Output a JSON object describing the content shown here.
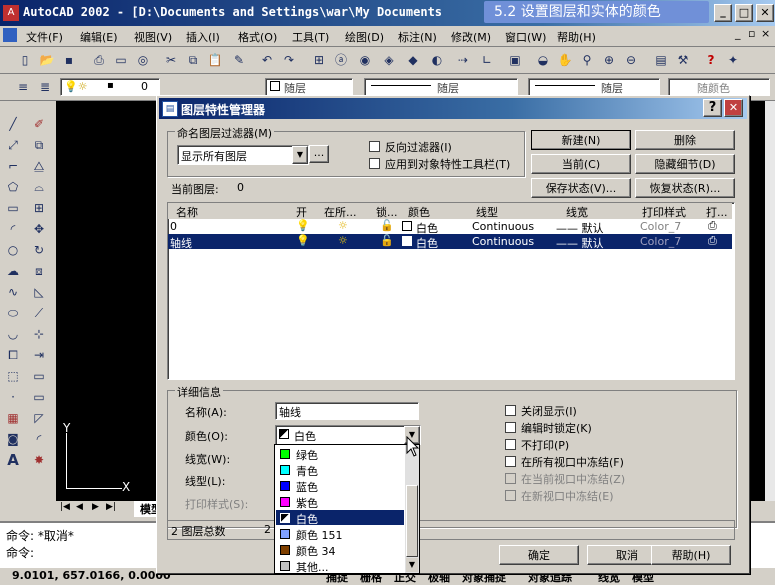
{
  "app": {
    "title": "AutoCAD 2002 - [D:\\Documents and Settings\\war\\My Documents",
    "overlay_title": "5.2 设置图层和实体的颜色",
    "menu": [
      "文件(F)",
      "编辑(E)",
      "视图(V)",
      "插入(I)",
      "格式(O)",
      "工具(T)",
      "绘图(D)",
      "标注(N)",
      "修改(M)",
      "窗口(W)",
      "帮助(H)"
    ],
    "layer_combo": "0",
    "bylayer": "随层",
    "bycolor": "随颜色",
    "model_tab": "模型",
    "command_lines": [
      "命令:  *取消*",
      "命令:"
    ],
    "coords": "9.0101,   657.0166, 0.0000",
    "status_items": [
      "捕捉",
      "栅格",
      "正交",
      "极轴",
      "对象捕捉",
      "对象追踪",
      "线宽",
      "模型"
    ],
    "ucs_x": "X",
    "ucs_y": "Y"
  },
  "dialog": {
    "title": "图层特性管理器",
    "filter_group": "命名图层过滤器(M)",
    "filter_value": "显示所有图层",
    "filter_more": "...",
    "invert_filter": "反向过滤器(I)",
    "apply_toolbar": "应用到对象特性工具栏(T)",
    "current_layer_label": "当前图层:",
    "current_layer": "0",
    "buttons": {
      "new": "新建(N)",
      "delete": "删除",
      "current": "当前(C)",
      "hide_details": "隐藏细节(D)",
      "save_state": "保存状态(V)...",
      "restore_state": "恢复状态(R)...",
      "ok": "确定",
      "cancel": "取消",
      "help": "帮助(H)"
    },
    "columns": [
      "名称",
      "开",
      "在所...",
      "锁...",
      "颜色",
      "线型",
      "线宽",
      "打印样式",
      "打..."
    ],
    "layers": [
      {
        "name": "0",
        "color": "白色",
        "linetype": "Continuous",
        "lineweight": "—— 默认",
        "plotstyle": "Color_7",
        "selected": false
      },
      {
        "name": "轴线",
        "color": "白色",
        "linetype": "Continuous",
        "lineweight": "—— 默认",
        "plotstyle": "Color_7",
        "selected": true
      }
    ],
    "details": {
      "group": "详细信息",
      "name_label": "名称(A):",
      "name_value": "轴线",
      "color_label": "颜色(O):",
      "color_value": "白色",
      "lineweight_label": "线宽(W):",
      "linetype_label": "线型(L):",
      "plotstyle_label": "打印样式(S):",
      "off": "关闭显示(I)",
      "lock": "编辑时锁定(K)",
      "noplot": "不打印(P)",
      "freeze_all": "在所有视口中冻结(F)",
      "freeze_current": "在当前视口中冻结(Z)",
      "freeze_new": "在新视口中冻结(E)"
    },
    "color_options": [
      {
        "label": "绿色",
        "swatch": "#00ff00"
      },
      {
        "label": "青色",
        "swatch": "#00ffff"
      },
      {
        "label": "蓝色",
        "swatch": "#0000ff"
      },
      {
        "label": "紫色",
        "swatch": "#ff00ff"
      },
      {
        "label": "白色",
        "swatch": "#ffffff"
      },
      {
        "label": "颜色 151",
        "swatch": "#7fa0ff"
      },
      {
        "label": "颜色 34",
        "swatch": "#7f4000"
      },
      {
        "label": "其他...",
        "swatch": "#c0c0c0"
      }
    ],
    "total_label": "2 图层总数",
    "total_shown": "2"
  }
}
